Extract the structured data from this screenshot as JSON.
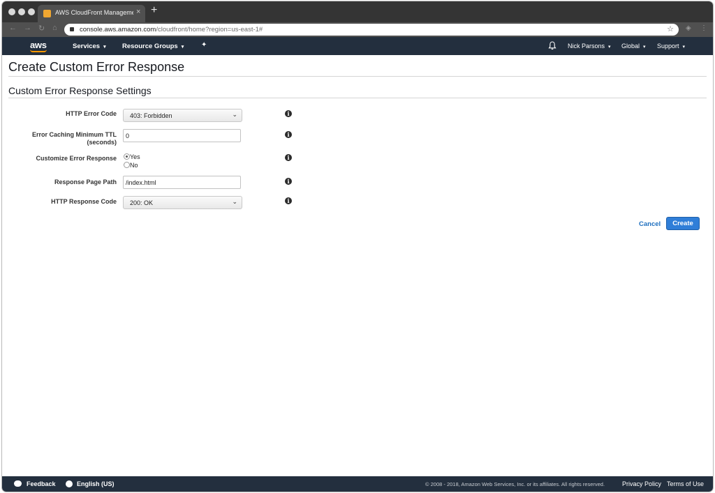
{
  "browser": {
    "tab_title": "AWS CloudFront Management",
    "tab_close": "×",
    "new_tab": "+",
    "url_host": "console.aws.amazon.com",
    "url_path": "/cloudfront/home?region=us-east-1#",
    "bookmark_star": "☆"
  },
  "nav": {
    "services": "Services",
    "resource_groups": "Resource Groups",
    "user": "Nick Parsons",
    "region": "Global",
    "support": "Support",
    "caret": "▾",
    "logo": "aws"
  },
  "page": {
    "title": "Create Custom Error Response",
    "section_title": "Custom Error Response Settings"
  },
  "form": {
    "http_error_code": {
      "label": "HTTP Error Code",
      "value": "403: Forbidden"
    },
    "ttl": {
      "label_line1": "Error Caching Minimum TTL",
      "label_line2": "(seconds)",
      "value": "0"
    },
    "customize": {
      "label": "Customize Error Response",
      "option_yes": "Yes",
      "option_no": "No",
      "selected": "Yes"
    },
    "response_page_path": {
      "label": "Response Page Path",
      "value": "/index.html"
    },
    "http_response_code": {
      "label": "HTTP Response Code",
      "value": "200: OK"
    },
    "info_glyph": "i",
    "select_chevron": "⌄"
  },
  "actions": {
    "cancel": "Cancel",
    "create": "Create"
  },
  "footer": {
    "feedback": "Feedback",
    "language": "English (US)",
    "copyright": "© 2008 - 2018, Amazon Web Services, Inc. or its affiliates. All rights reserved.",
    "privacy": "Privacy Policy",
    "terms": "Terms of Use"
  },
  "colors": {
    "nav_bg": "#232f3e",
    "primary_button": "#2f7ed8",
    "link": "#1e6fbf",
    "aws_orange": "#ff9900"
  }
}
